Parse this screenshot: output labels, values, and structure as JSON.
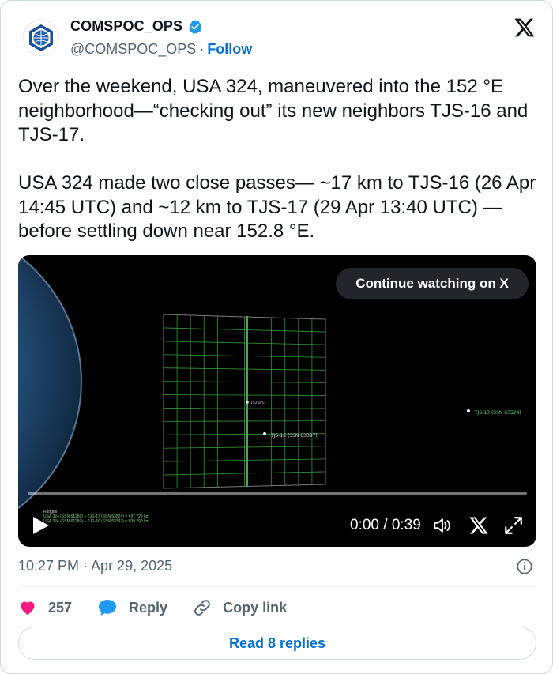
{
  "account": {
    "display_name": "COMSPOC_OPS",
    "handle": "@COMSPOC_OPS",
    "separator": "·",
    "follow_label": "Follow",
    "verified_color": "#1d9bf0"
  },
  "tweet": {
    "text": "Over the weekend, USA 324, maneuvered into the 152 °E neighborhood—“checking out” its new neighbors TJS-16 and TJS-17.\n\nUSA 324 made two close passes— ~17 km to TJS-16 (26 Apr 14:45 UTC) and ~12 km to TJS-17 (29 Apr 13:40 UTC) — before settling down near 152.8 °E.",
    "timestamp": "10:27 PM · Apr 29, 2025"
  },
  "video": {
    "continue_label": "Continue watching on X",
    "time": "0:00 / 0:39",
    "grid_center_label": "152.8°E",
    "label_tjs16": "TJS-16 (SSN 63397)",
    "label_tjs17": "TJS-17 (SSN 63524)",
    "legend_title": "Ranges",
    "legend_line1": "USA 324 (SSN 61280) – TJS-17 (SSN 63524) = 497.729 km",
    "legend_line2": "USA 324 (SSN 61280) – TJS-16 (SSN 63397) = 699.290 km",
    "grid_color": "#3fbf3f",
    "label_color": "#4cd964"
  },
  "actions": {
    "like_count": "257",
    "reply_label": "Reply",
    "copy_label": "Copy link",
    "like_color": "#f91880",
    "reply_color": "#1d9bf0"
  },
  "read_replies_label": "Read 8 replies"
}
